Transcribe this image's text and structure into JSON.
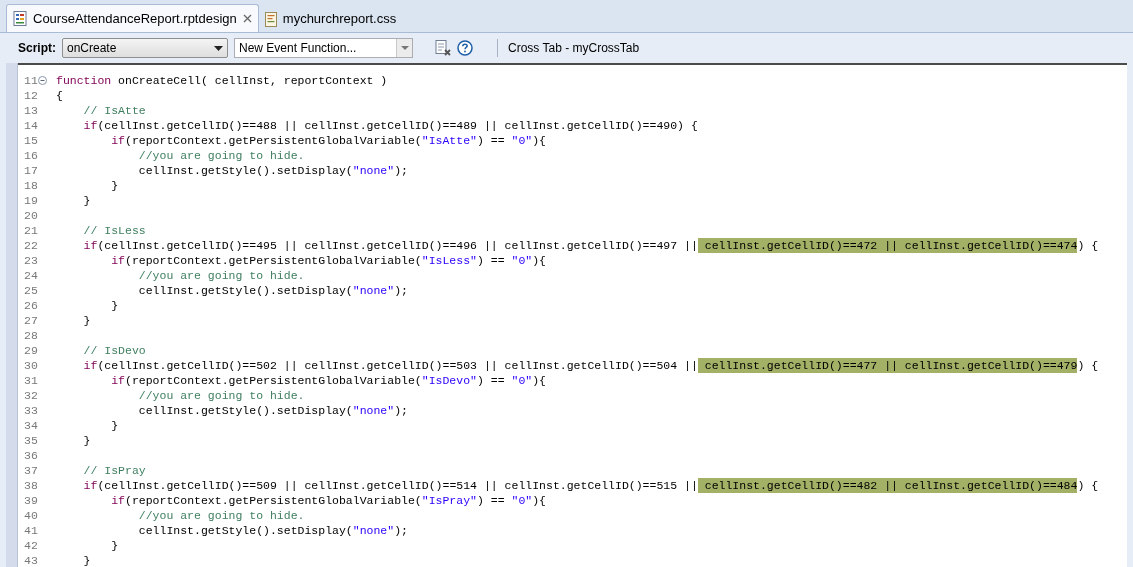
{
  "tabs": [
    {
      "label": "CourseAttendanceReport.rptdesign",
      "selected": true,
      "closable": true,
      "kind": "report"
    },
    {
      "label": "mychurchreport.css",
      "selected": false,
      "closable": false,
      "kind": "css"
    }
  ],
  "toolbar": {
    "script_label": "Script:",
    "script_select": "onCreate",
    "function_select": "New Event Function...",
    "context": "Cross Tab - myCrossTab"
  },
  "code_lines": [
    {
      "n": "11",
      "fold": true,
      "tokens": [
        {
          "kind": "keyword",
          "text": "function"
        },
        {
          "kind": "plain",
          "text": " onCreateCell( cellInst, reportContext )"
        }
      ]
    },
    {
      "n": "12",
      "fold": false,
      "tokens": [
        {
          "kind": "plain",
          "text": "{"
        }
      ]
    },
    {
      "n": "13",
      "fold": false,
      "tokens": [
        {
          "kind": "comment",
          "text": "    // IsAtte"
        }
      ]
    },
    {
      "n": "14",
      "fold": false,
      "tokens": [
        {
          "kind": "keyword",
          "text": "    if"
        },
        {
          "kind": "plain",
          "text": "(cellInst.getCellID()==488 || cellInst.getCellID()==489 || cellInst.getCellID()==490) {"
        }
      ]
    },
    {
      "n": "15",
      "fold": false,
      "tokens": [
        {
          "kind": "keyword",
          "text": "        if"
        },
        {
          "kind": "plain",
          "text": "(reportContext.getPersistentGlobalVariable("
        },
        {
          "kind": "string",
          "text": "\"IsAtte\""
        },
        {
          "kind": "plain",
          "text": ") == "
        },
        {
          "kind": "string",
          "text": "\"0\""
        },
        {
          "kind": "plain",
          "text": "){"
        }
      ]
    },
    {
      "n": "16",
      "fold": false,
      "tokens": [
        {
          "kind": "comment",
          "text": "            //you are going to hide."
        }
      ]
    },
    {
      "n": "17",
      "fold": false,
      "tokens": [
        {
          "kind": "plain",
          "text": "            cellInst.getStyle().setDisplay("
        },
        {
          "kind": "string",
          "text": "\"none\""
        },
        {
          "kind": "plain",
          "text": ");"
        }
      ]
    },
    {
      "n": "18",
      "fold": false,
      "tokens": [
        {
          "kind": "plain",
          "text": "        }"
        }
      ]
    },
    {
      "n": "19",
      "fold": false,
      "tokens": [
        {
          "kind": "plain",
          "text": "    }"
        }
      ]
    },
    {
      "n": "20",
      "fold": false
    },
    {
      "n": "21",
      "fold": false,
      "tokens": [
        {
          "kind": "comment",
          "text": "    // IsLess"
        }
      ]
    },
    {
      "n": "22",
      "fold": false,
      "tokens": [
        {
          "kind": "keyword",
          "text": "    if"
        },
        {
          "kind": "plain",
          "text": "(cellInst.getCellID()==495 || cellInst.getCellID()==496 || cellInst.getCellID()==497 ||"
        },
        {
          "kind": "highlight",
          "text": " cellInst.getCellID()==472 || cellInst.getCellID()==474"
        },
        {
          "kind": "plain",
          "text": ") {"
        }
      ]
    },
    {
      "n": "23",
      "fold": false,
      "tokens": [
        {
          "kind": "keyword",
          "text": "        if"
        },
        {
          "kind": "plain",
          "text": "(reportContext.getPersistentGlobalVariable("
        },
        {
          "kind": "string",
          "text": "\"IsLess\""
        },
        {
          "kind": "plain",
          "text": ") == "
        },
        {
          "kind": "string",
          "text": "\"0\""
        },
        {
          "kind": "plain",
          "text": "){"
        }
      ]
    },
    {
      "n": "24",
      "fold": false,
      "tokens": [
        {
          "kind": "comment",
          "text": "            //you are going to hide."
        }
      ]
    },
    {
      "n": "25",
      "fold": false,
      "tokens": [
        {
          "kind": "plain",
          "text": "            cellInst.getStyle().setDisplay("
        },
        {
          "kind": "string",
          "text": "\"none\""
        },
        {
          "kind": "plain",
          "text": ");"
        }
      ]
    },
    {
      "n": "26",
      "fold": false,
      "tokens": [
        {
          "kind": "plain",
          "text": "        }"
        }
      ]
    },
    {
      "n": "27",
      "fold": false,
      "tokens": [
        {
          "kind": "plain",
          "text": "    }"
        }
      ]
    },
    {
      "n": "28",
      "fold": false
    },
    {
      "n": "29",
      "fold": false,
      "tokens": [
        {
          "kind": "comment",
          "text": "    // IsDevo"
        }
      ]
    },
    {
      "n": "30",
      "fold": false,
      "tokens": [
        {
          "kind": "keyword",
          "text": "    if"
        },
        {
          "kind": "plain",
          "text": "(cellInst.getCellID()==502 || cellInst.getCellID()==503 || cellInst.getCellID()==504 ||"
        },
        {
          "kind": "highlight",
          "text": " cellInst.getCellID()==477 || cellInst.getCellID()==479"
        },
        {
          "kind": "plain",
          "text": ") {"
        }
      ]
    },
    {
      "n": "31",
      "fold": false,
      "tokens": [
        {
          "kind": "keyword",
          "text": "        if"
        },
        {
          "kind": "plain",
          "text": "(reportContext.getPersistentGlobalVariable("
        },
        {
          "kind": "string",
          "text": "\"IsDevo\""
        },
        {
          "kind": "plain",
          "text": ") == "
        },
        {
          "kind": "string",
          "text": "\"0\""
        },
        {
          "kind": "plain",
          "text": "){"
        }
      ]
    },
    {
      "n": "32",
      "fold": false,
      "tokens": [
        {
          "kind": "comment",
          "text": "            //you are going to hide."
        }
      ]
    },
    {
      "n": "33",
      "fold": false,
      "tokens": [
        {
          "kind": "plain",
          "text": "            cellInst.getStyle().setDisplay("
        },
        {
          "kind": "string",
          "text": "\"none\""
        },
        {
          "kind": "plain",
          "text": ");"
        }
      ]
    },
    {
      "n": "34",
      "fold": false,
      "tokens": [
        {
          "kind": "plain",
          "text": "        }"
        }
      ]
    },
    {
      "n": "35",
      "fold": false,
      "tokens": [
        {
          "kind": "plain",
          "text": "    }"
        }
      ]
    },
    {
      "n": "36",
      "fold": false
    },
    {
      "n": "37",
      "fold": false,
      "tokens": [
        {
          "kind": "comment",
          "text": "    // IsPray"
        }
      ]
    },
    {
      "n": "38",
      "fold": false,
      "tokens": [
        {
          "kind": "keyword",
          "text": "    if"
        },
        {
          "kind": "plain",
          "text": "(cellInst.getCellID()==509 || cellInst.getCellID()==514 || cellInst.getCellID()==515 ||"
        },
        {
          "kind": "highlight",
          "text": " cellInst.getCellID()==482 || cellInst.getCellID()==484"
        },
        {
          "kind": "plain",
          "text": ") {"
        }
      ]
    },
    {
      "n": "39",
      "fold": false,
      "tokens": [
        {
          "kind": "keyword",
          "text": "        if"
        },
        {
          "kind": "plain",
          "text": "(reportContext.getPersistentGlobalVariable("
        },
        {
          "kind": "string",
          "text": "\"IsPray\""
        },
        {
          "kind": "plain",
          "text": ") == "
        },
        {
          "kind": "string",
          "text": "\"0\""
        },
        {
          "kind": "plain",
          "text": "){"
        }
      ]
    },
    {
      "n": "40",
      "fold": false,
      "tokens": [
        {
          "kind": "comment",
          "text": "            //you are going to hide."
        }
      ]
    },
    {
      "n": "41",
      "fold": false,
      "tokens": [
        {
          "kind": "plain",
          "text": "            cellInst.getStyle().setDisplay("
        },
        {
          "kind": "string",
          "text": "\"none\""
        },
        {
          "kind": "plain",
          "text": ");"
        }
      ]
    },
    {
      "n": "42",
      "fold": false,
      "tokens": [
        {
          "kind": "plain",
          "text": "        }"
        }
      ]
    },
    {
      "n": "43",
      "fold": false,
      "tokens": [
        {
          "kind": "plain",
          "text": "    }"
        }
      ]
    }
  ]
}
